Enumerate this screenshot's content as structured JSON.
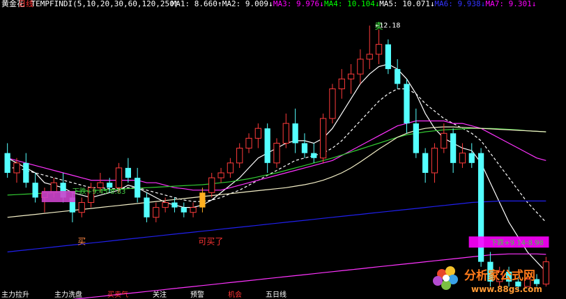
{
  "header": {
    "stock": "黄金花",
    "period": "日线",
    "indicator": "TEMPFINDI(5,10,20,30,60,120,250)",
    "ma": [
      {
        "label": "MA1:",
        "value": "8.660",
        "arrow": "↑",
        "color": "#ffffff"
      },
      {
        "label": "MA2:",
        "value": "9.009",
        "arrow": "↓",
        "color": "#ffffff"
      },
      {
        "label": "MA3:",
        "value": "9.976",
        "arrow": "↓",
        "color": "#ff00ff"
      },
      {
        "label": "MA4:",
        "value": "10.104",
        "arrow": "↓",
        "color": "#00ff00"
      },
      {
        "label": "MA5:",
        "value": "10.071",
        "arrow": "↓",
        "color": "#ffffff"
      },
      {
        "label": "MA6:",
        "value": "9.938",
        "arrow": "↓",
        "color": "#3333ff"
      },
      {
        "label": "MA7:",
        "value": "9.301",
        "arrow": "↓",
        "color": "#ff00ff"
      }
    ]
  },
  "colors": {
    "background": "#000000",
    "up": "#ff3b3b",
    "down": "#54ffff",
    "ma_white": "#ffffff",
    "ma_magenta": "#ff33ff",
    "ma_green": "#33cc33",
    "ma_blue": "#2020ee",
    "ma_cream": "#f5f0c8"
  },
  "chart_data": {
    "type": "candlestick",
    "ylim": [
      7.0,
      12.5
    ],
    "peak_label": "12.18",
    "candles": [
      {
        "o": 9.6,
        "h": 9.8,
        "l": 9.1,
        "c": 9.2
      },
      {
        "o": 9.2,
        "h": 9.5,
        "l": 9.0,
        "c": 9.4
      },
      {
        "o": 9.4,
        "h": 9.6,
        "l": 8.9,
        "c": 9.0
      },
      {
        "o": 9.0,
        "h": 9.2,
        "l": 8.6,
        "c": 8.7
      },
      {
        "o": 8.7,
        "h": 8.9,
        "l": 8.4,
        "c": 8.8
      },
      {
        "o": 8.8,
        "h": 9.1,
        "l": 8.7,
        "c": 9.0
      },
      {
        "o": 9.0,
        "h": 9.2,
        "l": 8.6,
        "c": 8.7
      },
      {
        "o": 8.7,
        "h": 8.8,
        "l": 8.2,
        "c": 8.4
      },
      {
        "o": 8.4,
        "h": 8.7,
        "l": 8.3,
        "c": 8.6
      },
      {
        "o": 8.6,
        "h": 9.0,
        "l": 8.5,
        "c": 8.9
      },
      {
        "o": 8.9,
        "h": 9.2,
        "l": 8.8,
        "c": 9.0
      },
      {
        "o": 9.0,
        "h": 9.1,
        "l": 8.8,
        "c": 8.9
      },
      {
        "o": 8.9,
        "h": 9.4,
        "l": 8.8,
        "c": 9.3
      },
      {
        "o": 9.3,
        "h": 9.5,
        "l": 9.0,
        "c": 9.1
      },
      {
        "o": 9.1,
        "h": 9.3,
        "l": 8.6,
        "c": 8.7
      },
      {
        "o": 8.7,
        "h": 8.8,
        "l": 8.2,
        "c": 8.3
      },
      {
        "o": 8.3,
        "h": 8.6,
        "l": 8.2,
        "c": 8.5
      },
      {
        "o": 8.5,
        "h": 8.7,
        "l": 8.4,
        "c": 8.6
      },
      {
        "o": 8.6,
        "h": 8.7,
        "l": 8.4,
        "c": 8.5
      },
      {
        "o": 8.5,
        "h": 8.6,
        "l": 8.3,
        "c": 8.4
      },
      {
        "o": 8.4,
        "h": 8.6,
        "l": 8.3,
        "c": 8.5
      },
      {
        "o": 8.5,
        "h": 8.9,
        "l": 8.4,
        "c": 8.8,
        "highlight": true
      },
      {
        "o": 8.8,
        "h": 9.2,
        "l": 8.7,
        "c": 9.1
      },
      {
        "o": 9.1,
        "h": 9.3,
        "l": 9.0,
        "c": 9.2
      },
      {
        "o": 9.2,
        "h": 9.5,
        "l": 9.1,
        "c": 9.4
      },
      {
        "o": 9.4,
        "h": 9.8,
        "l": 9.3,
        "c": 9.7
      },
      {
        "o": 9.7,
        "h": 10.0,
        "l": 9.6,
        "c": 9.9
      },
      {
        "o": 9.9,
        "h": 10.2,
        "l": 9.7,
        "c": 10.1
      },
      {
        "o": 10.1,
        "h": 10.2,
        "l": 9.2,
        "c": 9.4
      },
      {
        "o": 9.4,
        "h": 9.9,
        "l": 9.3,
        "c": 9.8
      },
      {
        "o": 9.8,
        "h": 10.4,
        "l": 9.7,
        "c": 10.2
      },
      {
        "o": 10.2,
        "h": 10.5,
        "l": 9.6,
        "c": 9.8
      },
      {
        "o": 9.8,
        "h": 10.0,
        "l": 9.5,
        "c": 9.6
      },
      {
        "o": 9.6,
        "h": 9.8,
        "l": 9.4,
        "c": 9.5
      },
      {
        "o": 9.5,
        "h": 10.4,
        "l": 9.4,
        "c": 10.3
      },
      {
        "o": 10.3,
        "h": 11.0,
        "l": 10.2,
        "c": 10.9
      },
      {
        "o": 10.9,
        "h": 11.3,
        "l": 10.7,
        "c": 11.1
      },
      {
        "o": 11.1,
        "h": 11.4,
        "l": 10.8,
        "c": 11.2
      },
      {
        "o": 11.2,
        "h": 11.7,
        "l": 11.0,
        "c": 11.5
      },
      {
        "o": 11.5,
        "h": 12.18,
        "l": 11.3,
        "c": 11.6
      },
      {
        "o": 11.6,
        "h": 12.1,
        "l": 11.4,
        "c": 11.8
      },
      {
        "o": 11.8,
        "h": 11.9,
        "l": 11.2,
        "c": 11.3
      },
      {
        "o": 11.3,
        "h": 11.5,
        "l": 10.9,
        "c": 11.0
      },
      {
        "o": 11.0,
        "h": 11.1,
        "l": 10.0,
        "c": 10.2
      },
      {
        "o": 10.2,
        "h": 10.5,
        "l": 9.5,
        "c": 9.6
      },
      {
        "o": 9.6,
        "h": 9.7,
        "l": 9.0,
        "c": 9.2
      },
      {
        "o": 9.2,
        "h": 9.8,
        "l": 9.0,
        "c": 9.7
      },
      {
        "o": 9.7,
        "h": 10.2,
        "l": 9.6,
        "c": 10.0
      },
      {
        "o": 10.0,
        "h": 10.1,
        "l": 9.2,
        "c": 9.4
      },
      {
        "o": 9.4,
        "h": 9.8,
        "l": 9.3,
        "c": 9.6
      },
      {
        "o": 9.6,
        "h": 9.8,
        "l": 9.3,
        "c": 9.4
      },
      {
        "o": 9.6,
        "h": 9.7,
        "l": 7.3,
        "c": 7.4
      },
      {
        "o": 7.4,
        "h": 7.6,
        "l": 6.9,
        "c": 7.0
      },
      {
        "o": 7.0,
        "h": 7.3,
        "l": 6.9,
        "c": 7.2
      },
      {
        "o": 7.2,
        "h": 7.3,
        "l": 6.9,
        "c": 7.0
      },
      {
        "o": 7.0,
        "h": 7.1,
        "l": 6.8,
        "c": 6.9
      },
      {
        "o": 6.9,
        "h": 7.1,
        "l": 6.9,
        "c": 7.05
      },
      {
        "o": 7.05,
        "h": 7.15,
        "l": 6.9,
        "c": 6.95
      },
      {
        "o": 6.95,
        "h": 7.5,
        "l": 6.9,
        "c": 7.4
      }
    ],
    "ma_series": [
      {
        "name": "MA1",
        "color_key": "ma_white",
        "values": [
          9.5,
          9.4,
          9.3,
          9.2,
          9.0,
          8.95,
          8.9,
          8.8,
          8.75,
          8.7,
          8.75,
          8.8,
          8.85,
          8.95,
          8.9,
          8.8,
          8.7,
          8.6,
          8.55,
          8.5,
          8.5,
          8.55,
          8.65,
          8.8,
          8.95,
          9.1,
          9.3,
          9.5,
          9.6,
          9.7,
          9.8,
          9.85,
          9.85,
          9.8,
          9.9,
          10.1,
          10.4,
          10.7,
          11.0,
          11.2,
          11.35,
          11.4,
          11.3,
          11.1,
          10.8,
          10.4,
          10.1,
          9.9,
          9.8,
          9.7,
          9.65,
          9.4,
          9.0,
          8.6,
          8.2,
          7.9,
          7.6,
          7.4,
          7.2
        ]
      },
      {
        "name": "MA2",
        "color_key": "ma_white",
        "dashed": true,
        "values": [
          9.3,
          9.3,
          9.25,
          9.2,
          9.15,
          9.1,
          9.05,
          9.0,
          8.95,
          8.9,
          8.9,
          8.88,
          8.88,
          8.9,
          8.9,
          8.85,
          8.8,
          8.75,
          8.7,
          8.65,
          8.62,
          8.62,
          8.65,
          8.7,
          8.78,
          8.85,
          8.95,
          9.05,
          9.15,
          9.25,
          9.35,
          9.45,
          9.5,
          9.55,
          9.6,
          9.7,
          9.85,
          10.05,
          10.25,
          10.45,
          10.65,
          10.8,
          10.9,
          10.9,
          10.8,
          10.6,
          10.45,
          10.3,
          10.2,
          10.1,
          10.0,
          9.85,
          9.6,
          9.35,
          9.1,
          8.85,
          8.6,
          8.4,
          8.2
        ]
      },
      {
        "name": "MA3",
        "color_key": "ma_magenta",
        "values": [
          9.5,
          9.45,
          9.4,
          9.35,
          9.3,
          9.25,
          9.2,
          9.15,
          9.1,
          9.05,
          9.05,
          9.05,
          9.05,
          9.05,
          9.05,
          9.0,
          9.0,
          8.95,
          8.9,
          8.88,
          8.85,
          8.85,
          8.85,
          8.85,
          8.9,
          8.95,
          9.0,
          9.05,
          9.1,
          9.15,
          9.2,
          9.25,
          9.3,
          9.35,
          9.4,
          9.45,
          9.55,
          9.65,
          9.75,
          9.85,
          9.95,
          10.05,
          10.15,
          10.2,
          10.25,
          10.25,
          10.25,
          10.25,
          10.2,
          10.2,
          10.15,
          10.1,
          10.0,
          9.9,
          9.8,
          9.7,
          9.6,
          9.5,
          9.45
        ]
      },
      {
        "name": "MA4",
        "color_key": "ma_green",
        "values": [
          8.75,
          8.76,
          8.77,
          8.78,
          8.79,
          8.8,
          8.81,
          8.82,
          8.83,
          8.84,
          8.85,
          8.86,
          8.87,
          8.88,
          8.89,
          8.9,
          8.91,
          8.92,
          8.93,
          8.94,
          8.95,
          8.96,
          8.98,
          9.0,
          9.02,
          9.05,
          9.08,
          9.12,
          9.16,
          9.2,
          9.25,
          9.3,
          9.35,
          9.4,
          9.45,
          9.5,
          9.56,
          9.62,
          9.68,
          9.74,
          9.8,
          9.86,
          9.92,
          9.97,
          10.0,
          10.03,
          10.05,
          10.07,
          10.08,
          10.09,
          10.1,
          10.1,
          10.1,
          10.09,
          10.08,
          10.07,
          10.05,
          10.04,
          10.03
        ]
      },
      {
        "name": "MA5",
        "color_key": "ma_cream",
        "values": [
          8.3,
          8.32,
          8.34,
          8.36,
          8.38,
          8.4,
          8.42,
          8.44,
          8.46,
          8.48,
          8.5,
          8.52,
          8.54,
          8.56,
          8.58,
          8.6,
          8.62,
          8.64,
          8.66,
          8.68,
          8.7,
          8.72,
          8.74,
          8.76,
          8.78,
          8.8,
          8.82,
          8.84,
          8.86,
          8.88,
          8.9,
          8.93,
          8.96,
          9.0,
          9.05,
          9.12,
          9.2,
          9.3,
          9.42,
          9.55,
          9.68,
          9.8,
          9.92,
          10.0,
          10.06,
          10.1,
          10.12,
          10.13,
          10.13,
          10.12,
          10.11,
          10.1,
          10.09,
          10.08,
          10.07,
          10.06,
          10.05,
          10.04,
          10.03
        ]
      },
      {
        "name": "MA6",
        "color_key": "ma_blue",
        "values": [
          7.6,
          7.62,
          7.64,
          7.66,
          7.68,
          7.7,
          7.72,
          7.74,
          7.76,
          7.78,
          7.8,
          7.82,
          7.84,
          7.86,
          7.88,
          7.9,
          7.92,
          7.94,
          7.96,
          7.98,
          8.0,
          8.02,
          8.04,
          8.06,
          8.08,
          8.1,
          8.12,
          8.14,
          8.16,
          8.18,
          8.2,
          8.22,
          8.24,
          8.26,
          8.28,
          8.3,
          8.32,
          8.34,
          8.36,
          8.38,
          8.4,
          8.42,
          8.44,
          8.46,
          8.48,
          8.5,
          8.52,
          8.54,
          8.56,
          8.58,
          8.6,
          8.61,
          8.62,
          8.63,
          8.63,
          8.63,
          8.63,
          8.63,
          8.63
        ]
      },
      {
        "name": "MA7",
        "color_key": "ma_magenta",
        "values": [
          6.5,
          6.52,
          6.54,
          6.56,
          6.58,
          6.6,
          6.62,
          6.64,
          6.66,
          6.68,
          6.7,
          6.72,
          6.74,
          6.76,
          6.78,
          6.8,
          6.82,
          6.84,
          6.86,
          6.88,
          6.9,
          6.92,
          6.94,
          6.96,
          6.98,
          7.0,
          7.02,
          7.04,
          7.06,
          7.08,
          7.1,
          7.12,
          7.14,
          7.16,
          7.18,
          7.2,
          7.22,
          7.24,
          7.26,
          7.28,
          7.3,
          7.32,
          7.34,
          7.36,
          7.38,
          7.4,
          7.42,
          7.44,
          7.46,
          7.48,
          7.5,
          7.52,
          7.54,
          7.55,
          7.56,
          7.56,
          7.56,
          7.56,
          7.55
        ]
      }
    ],
    "annotations": [
      {
        "text": "买",
        "index": 8,
        "price": 7.95,
        "color": "#ff8844",
        "below": true
      },
      {
        "text": "可买了",
        "index": 21,
        "price": 7.95,
        "color": "#ff3333",
        "below": true
      },
      {
        "text": "卖",
        "index": 40,
        "price": 12.0,
        "color": "#44ff44",
        "above": true
      }
    ],
    "labels": [
      {
        "text": "下跌+9.45-8.83",
        "index": 7,
        "price": 8.83,
        "color": "#44cc44"
      },
      {
        "text": "下跌+9.14-8.98",
        "index": 52,
        "price": 7.8,
        "color": "#44cc44"
      }
    ],
    "boxes": [
      {
        "index_from": 4,
        "index_to": 7,
        "price": 8.72,
        "color": "#cc44cc"
      },
      {
        "index_from": 50,
        "index_to": 58,
        "price": 7.8,
        "color": "#ff00ff"
      }
    ]
  },
  "footer": {
    "segments": [
      {
        "text": "主力拉升",
        "color": "#ffffff"
      },
      {
        "text": "主力洗盘",
        "color": "#ffffff"
      },
      {
        "text": "买卖气",
        "color": "#ff3333"
      },
      {
        "text": "关注",
        "color": "#ffffff"
      },
      {
        "text": "预警",
        "color": "#ffffff"
      },
      {
        "text": "机会",
        "color": "#ff3333"
      },
      {
        "text": "五日线",
        "color": "#ffffff"
      }
    ]
  },
  "watermark": {
    "name": "分析家公式网",
    "url": "www.88gs.com"
  }
}
